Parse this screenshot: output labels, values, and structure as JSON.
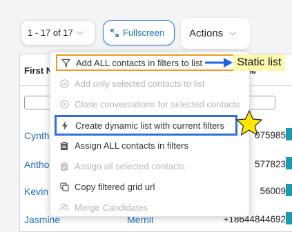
{
  "toolbar": {
    "paging_label": "1 - 17 of 17",
    "fullscreen_label": "Fullscreen",
    "actions_label": "Actions"
  },
  "grid": {
    "header_first": "First N",
    "header_phone": "ne",
    "rows": [
      {
        "first": "Cynth",
        "mid": "",
        "phone": "075985"
      },
      {
        "first": "Antho",
        "mid": "",
        "phone": "577823"
      },
      {
        "first": "Kevin",
        "mid": "",
        "phone": "56009"
      },
      {
        "first": "Jasmine",
        "mid": "Merrill",
        "phone": "+18644844692"
      }
    ]
  },
  "menu": {
    "items": [
      {
        "label": "Add ALL contacts in filters to list",
        "icon": "filter-icon",
        "enabled": true
      },
      {
        "label": "Add only selected contacts to list",
        "icon": "check-circle-icon",
        "enabled": false
      },
      {
        "label": "Close conversations for selected contacts",
        "icon": "x-circle-icon",
        "enabled": false
      },
      {
        "label": "Create dynamic list with current filters",
        "icon": "bolt-icon",
        "enabled": true
      },
      {
        "label": "Assign ALL contacts in filters",
        "icon": "clipboard-icon",
        "enabled": true
      },
      {
        "label": "Assign all selected contacts",
        "icon": "clipboard-check-icon",
        "enabled": false
      },
      {
        "label": "Copy filtered grid url",
        "icon": "copy-icon",
        "enabled": true
      },
      {
        "label": "Merge Candidates",
        "icon": "users-icon",
        "enabled": false
      }
    ]
  },
  "annotations": {
    "static_list_label": "Static list"
  },
  "colors": {
    "link_blue": "#1f6fbf",
    "highlight_orange": "#f09a1b",
    "highlight_blue": "#2d6fe0",
    "star_yellow": "#ffe600"
  }
}
